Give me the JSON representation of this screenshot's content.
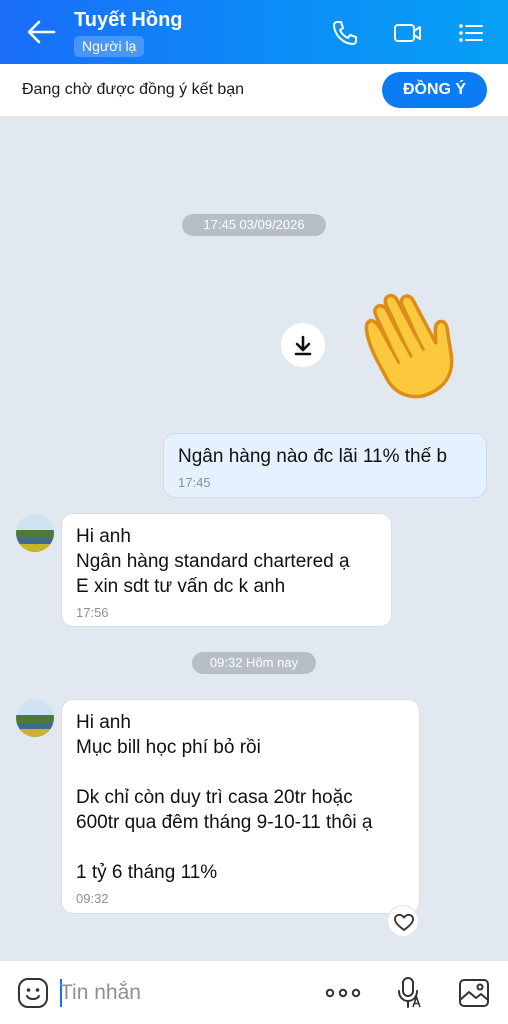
{
  "header": {
    "contact_name": "Tuyết Hồng",
    "badge": "Người lạ",
    "icons": [
      "back-arrow-icon",
      "phone-icon",
      "video-camera-icon",
      "menu-list-icon"
    ]
  },
  "request_bar": {
    "text": "Đang chờ được đồng ý kết bạn",
    "accept_label": "ĐỒNG Ý"
  },
  "chat": {
    "time_chip_1": "17:45 03/09/2026",
    "time_chip_2": "09:32 Hôm nay",
    "sent_message": {
      "text": "Ngân hàng nào đc lãi 11% thế b",
      "time": "17:45"
    },
    "received_1": {
      "lines": [
        "Hi anh",
        "Ngân hàng standard chartered ạ",
        "E xin sdt tư vấn dc k anh"
      ],
      "time": "17:56"
    },
    "received_2": {
      "lines": [
        "Hi anh",
        "Mục bill học phí bỏ rồi",
        "",
        "Dk chỉ còn duy trì casa 20tr hoặc",
        "600tr qua đêm tháng 9-10-11 thôi ạ",
        "",
        "1 tỷ 6 tháng 11%"
      ],
      "time": "09:32"
    }
  },
  "composer": {
    "placeholder": "Tin nhắn"
  },
  "colors": {
    "header_gradient_start": "#1a6dfa",
    "header_gradient_end": "#07a0f5",
    "accent": "#0a7cf4",
    "chat_background": "#e2e8ef",
    "sent_bubble": "#e5f1ff"
  }
}
